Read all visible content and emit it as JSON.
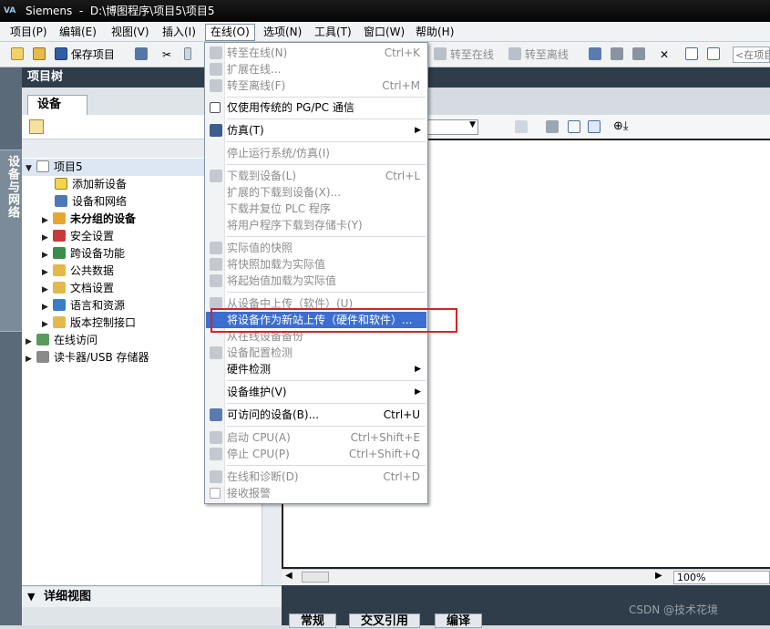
{
  "title": {
    "app": "Siemens",
    "path": "D:\\博图程序\\项目5\\项目5"
  },
  "menubar": [
    {
      "label": "项目(P)"
    },
    {
      "label": "编辑(E)"
    },
    {
      "label": "视图(V)"
    },
    {
      "label": "插入(I)"
    },
    {
      "label": "在线(O)"
    },
    {
      "label": "选项(N)"
    },
    {
      "label": "工具(T)"
    },
    {
      "label": "窗口(W)"
    },
    {
      "label": "帮助(H)"
    }
  ],
  "toolbar": {
    "save_label": "保存项目",
    "go_online": "转至在线",
    "go_offline": "转至离线",
    "search_placeholder": "<在项目"
  },
  "left_strip": {
    "label": "设备与网络"
  },
  "project_tree": {
    "header": "项目树",
    "tab": "设备",
    "items": [
      {
        "label": "项目5"
      },
      {
        "label": "添加新设备"
      },
      {
        "label": "设备和网络"
      },
      {
        "label": "未分组的设备"
      },
      {
        "label": "安全设置"
      },
      {
        "label": "跨设备功能"
      },
      {
        "label": "公共数据"
      },
      {
        "label": "文档设置"
      },
      {
        "label": "语言和资源"
      },
      {
        "label": "版本控制接口"
      },
      {
        "label": "在线访问"
      },
      {
        "label": "读卡器/USB 存储器"
      }
    ]
  },
  "detail_view": {
    "header": "详细视图"
  },
  "bottom_tabs": [
    {
      "label": "常规"
    },
    {
      "label": "交叉引用"
    },
    {
      "label": "编译"
    }
  ],
  "zoom": "100%",
  "online_menu": {
    "items": [
      {
        "label": "转至在线(N)",
        "shortcut": "Ctrl+K"
      },
      {
        "label": "扩展在线..."
      },
      {
        "label": "转至离线(F)",
        "shortcut": "Ctrl+M"
      },
      {
        "label": "仅使用传统的 PG/PC 通信"
      },
      {
        "label": "仿真(T)"
      },
      {
        "label": "停止运行系统/仿真(I)"
      },
      {
        "label": "下载到设备(L)",
        "shortcut": "Ctrl+L"
      },
      {
        "label": "扩展的下载到设备(X)..."
      },
      {
        "label": "下载并复位 PLC 程序"
      },
      {
        "label": "将用户程序下载到存储卡(Y)"
      },
      {
        "label": "实际值的快照"
      },
      {
        "label": "将快照加载为实际值"
      },
      {
        "label": "将起始值加载为实际值"
      },
      {
        "label": "从设备中上传（软件）(U)"
      },
      {
        "label": "将设备作为新站上传（硬件和软件）..."
      },
      {
        "label": "从在线设备备份"
      },
      {
        "label": "设备配置检测"
      },
      {
        "label": "硬件检测"
      },
      {
        "label": "设备维护(V)"
      },
      {
        "label": "可访问的设备(B)...",
        "shortcut": "Ctrl+U"
      },
      {
        "label": "启动 CPU(A)",
        "shortcut": "Ctrl+Shift+E"
      },
      {
        "label": "停止 CPU(P)",
        "shortcut": "Ctrl+Shift+Q"
      },
      {
        "label": "在线和诊断(D)",
        "shortcut": "Ctrl+D"
      },
      {
        "label": "接收报警"
      }
    ]
  },
  "watermark": "CSDN @技术花境",
  "colors": {
    "highlight": "#3c6ecf",
    "annotation_box": "#d62229",
    "header_bg": "#2f3c49"
  }
}
